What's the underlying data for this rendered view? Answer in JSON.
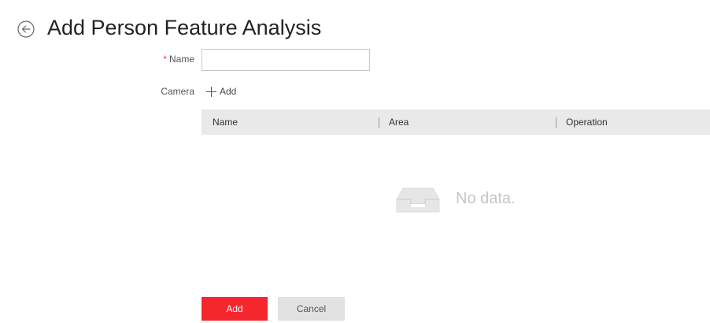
{
  "header": {
    "title": "Add Person Feature Analysis",
    "back_icon": "back-arrow-circle-icon"
  },
  "form": {
    "name_required_mark": "*",
    "name_label": "Name",
    "name_value": "",
    "name_placeholder": "",
    "camera_label": "Camera",
    "add_camera_label": "Add"
  },
  "table": {
    "columns": [
      "Name",
      "Area",
      "Operation"
    ],
    "rows": [],
    "empty_text": "No data."
  },
  "footer": {
    "add_label": "Add",
    "cancel_label": "Cancel"
  },
  "colors": {
    "primary": "#f5262e",
    "table_header_bg": "#e9e9e9",
    "required": "#ff3b3b"
  }
}
